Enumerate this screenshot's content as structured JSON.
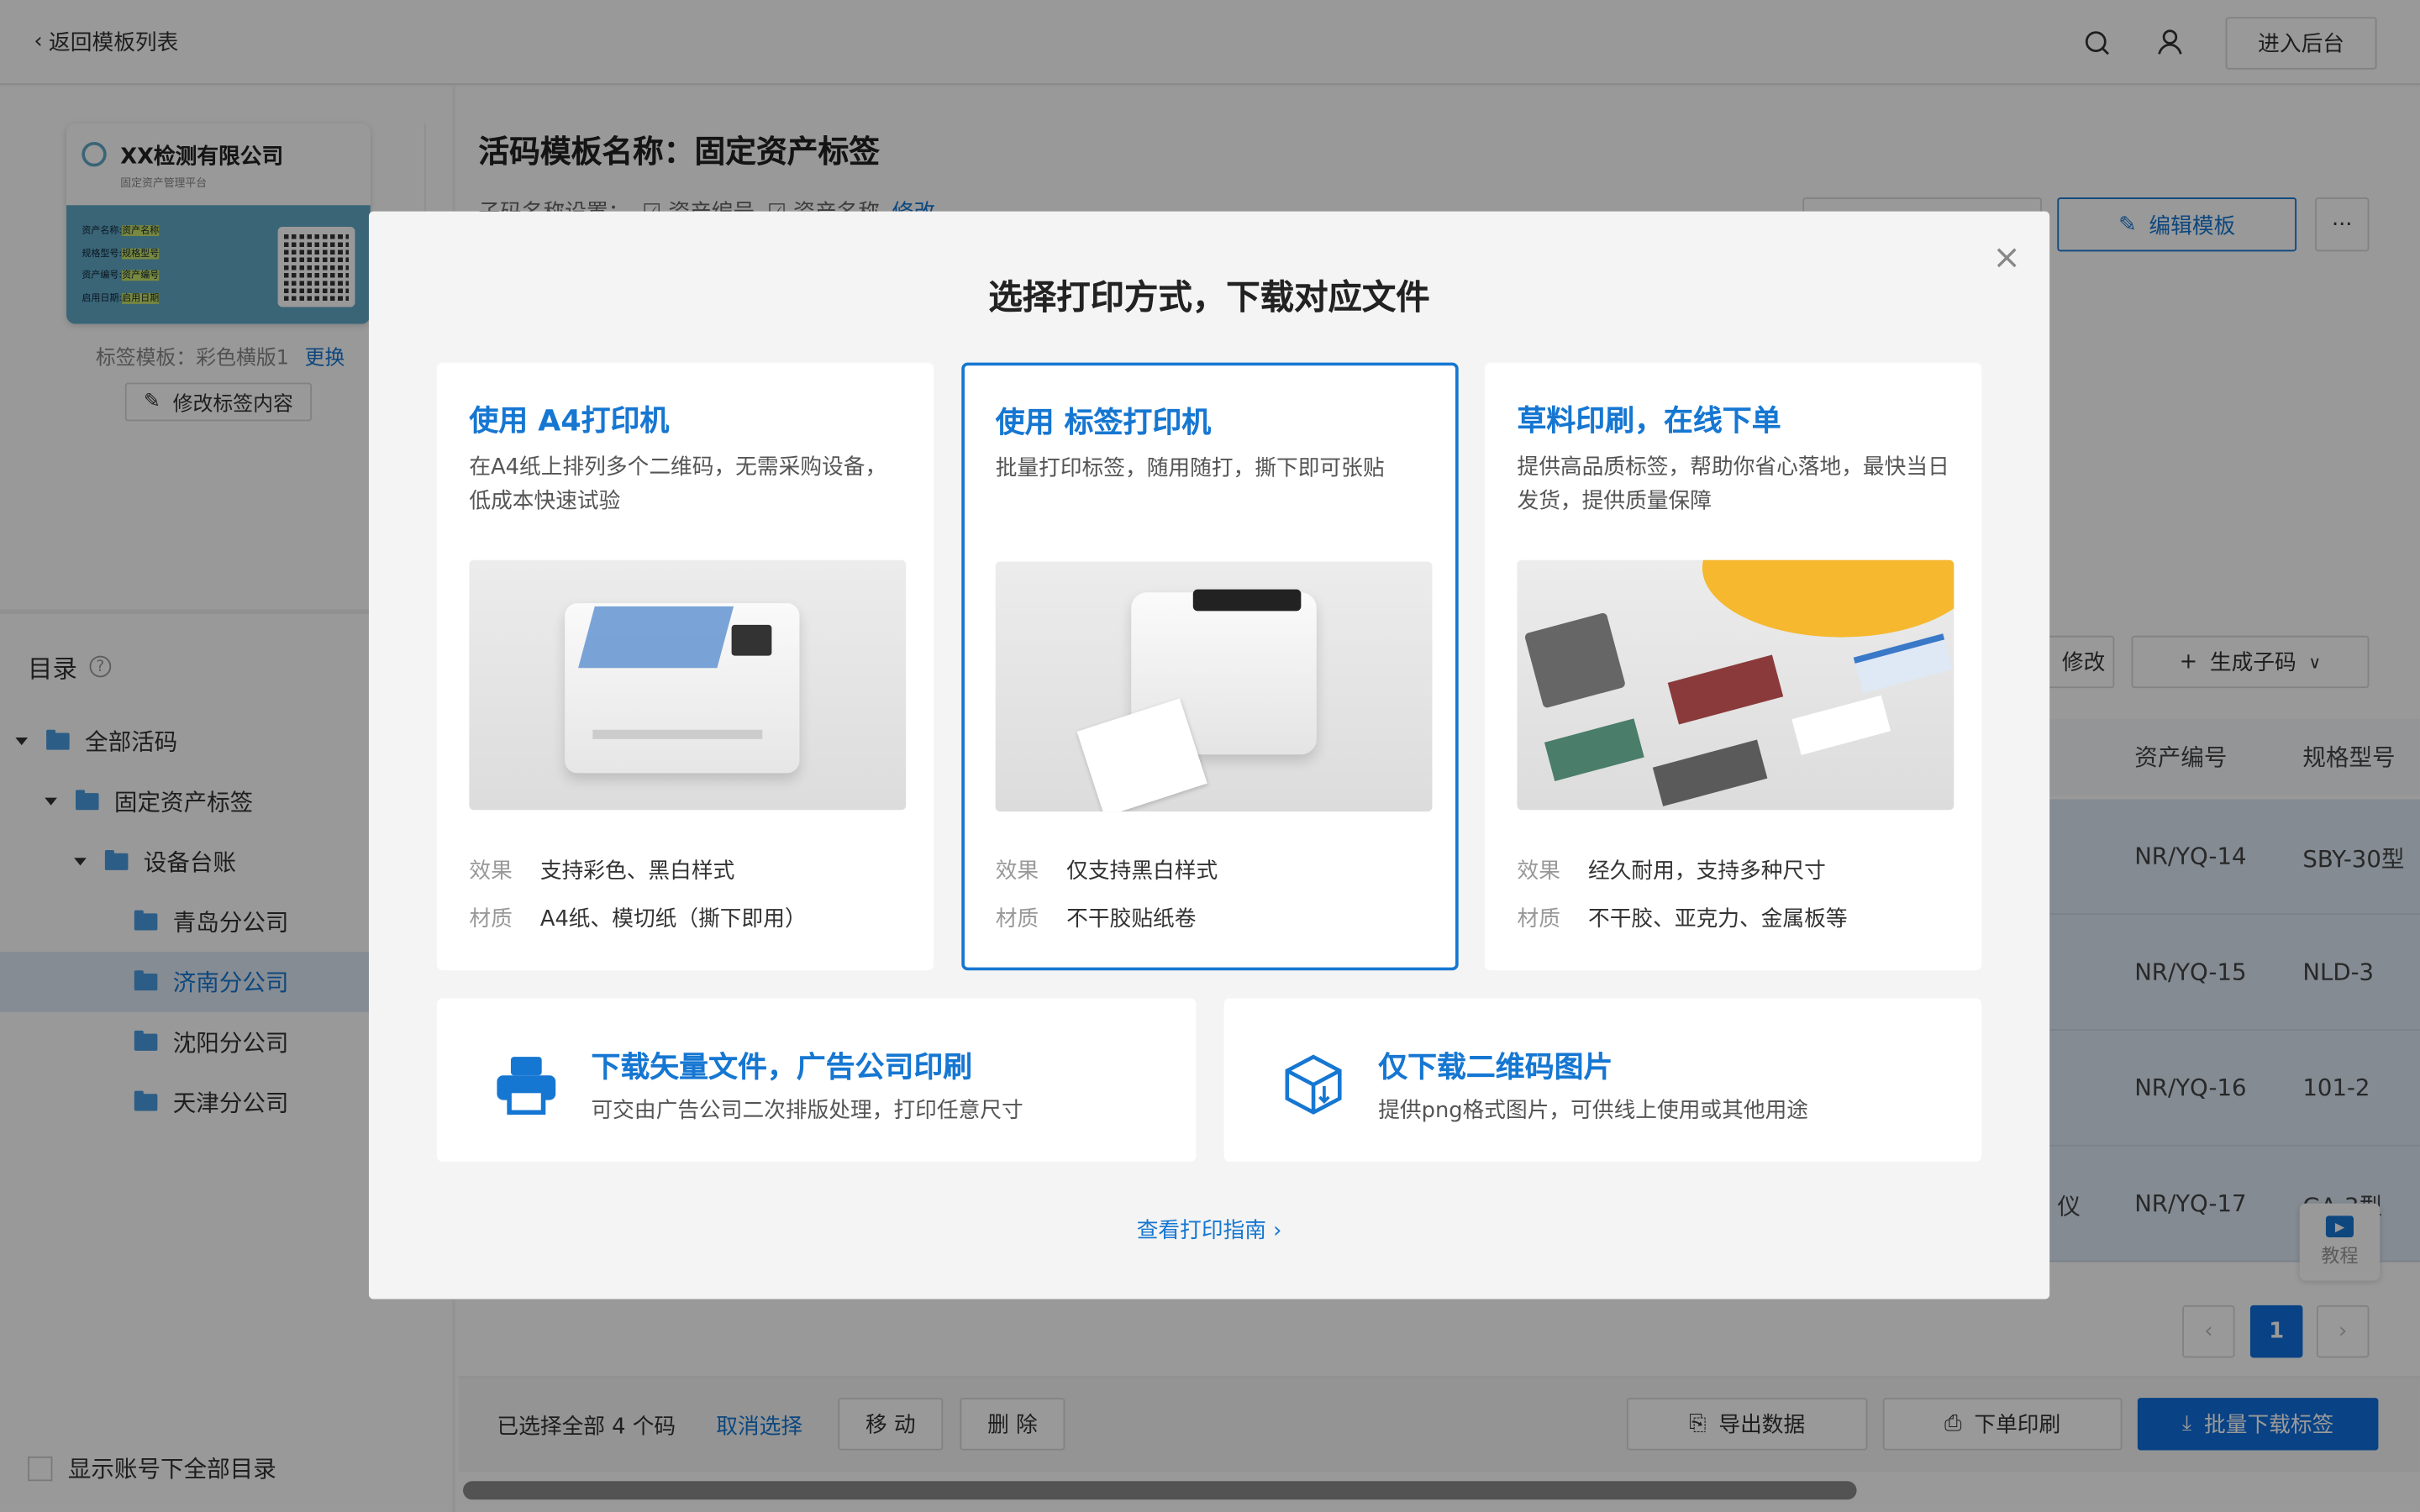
{
  "topbar": {
    "back_label": "返回模板列表",
    "admin_button": "进入后台",
    "search_icon": "search-icon",
    "user_icon": "user-icon"
  },
  "template_preview": {
    "company": "XX检测有限公司",
    "platform": "固定资产管理平台",
    "fields": [
      {
        "label": "资产名称:",
        "value": "资产名称"
      },
      {
        "label": "规格型号:",
        "value": "规格型号"
      },
      {
        "label": "资产编号:",
        "value": "资产编号"
      },
      {
        "label": "启用日期:",
        "value": "启用日期"
      }
    ],
    "template_label": "标签模板：彩色横版1",
    "change_link": "更换",
    "edit_content_button": "修改标签内容",
    "card_color": "#5fa8c6"
  },
  "header": {
    "title": "活码模板名称：固定资产标签",
    "subcode_setting_label": "子码名称设置：",
    "subcode_fields": [
      "资产编号",
      "资产名称"
    ],
    "modify_link": "修改",
    "edit_template_button": "编辑模板",
    "more_button": "···"
  },
  "directory": {
    "title": "目录",
    "help_icon": "help-circle-icon",
    "items": [
      {
        "label": "全部活码",
        "level": 0,
        "expanded": true
      },
      {
        "label": "固定资产标签",
        "level": 1,
        "expanded": true
      },
      {
        "label": "设备台账",
        "level": 2,
        "expanded": true
      },
      {
        "label": "青岛分公司",
        "level": 3
      },
      {
        "label": "济南分公司",
        "level": 3,
        "selected": true
      },
      {
        "label": "沈阳分公司",
        "level": 3
      },
      {
        "label": "天津分公司",
        "level": 3
      }
    ],
    "show_all_checkbox": "显示账号下全部目录",
    "show_all_checked": false
  },
  "table": {
    "modify_button": "修改",
    "generate_button": "生成子码",
    "columns": [
      "资产编号",
      "规格型号"
    ],
    "rows": [
      {
        "partial_name": "",
        "asset_no": "NR/YQ-14",
        "model": "SBY-30型"
      },
      {
        "partial_name": "",
        "asset_no": "NR/YQ-15",
        "model": "NLD-3"
      },
      {
        "partial_name": "",
        "asset_no": "NR/YQ-16",
        "model": "101-2"
      },
      {
        "partial_name": "仪",
        "asset_no": "NR/YQ-17",
        "model": "GA-3型"
      }
    ],
    "pagination": {
      "current": "1"
    },
    "tutorial_label": "教程"
  },
  "bottombar": {
    "selected_text": "已选择全部 4 个码",
    "cancel_select": "取消选择",
    "move_button": "移 动",
    "delete_button": "删 除",
    "export_button": "导出数据",
    "order_print_button": "下单印刷",
    "batch_download_button": "批量下载标签"
  },
  "modal": {
    "title": "选择打印方式，下载对应文件",
    "close_icon": "close-icon",
    "options": [
      {
        "title": "使用 A4打印机",
        "desc": "在A4纸上排列多个二维码，无需采购设备，低成本快速试验",
        "effect_label": "效果",
        "effect": "支持彩色、黑白样式",
        "material_label": "材质",
        "material": "A4纸、模切纸（撕下即用）"
      },
      {
        "title": "使用 标签打印机",
        "desc": "批量打印标签，随用随打，撕下即可张贴",
        "effect_label": "效果",
        "effect": "仅支持黑白样式",
        "material_label": "材质",
        "material": "不干胶贴纸卷",
        "selected": true
      },
      {
        "title": "草料印刷，在线下单",
        "desc": "提供高品质标签，帮助你省心落地，最快当日发货，提供质量保障",
        "effect_label": "效果",
        "effect": "经久耐用，支持多种尺寸",
        "material_label": "材质",
        "material": "不干胶、亚克力、金属板等"
      }
    ],
    "downloads": [
      {
        "title": "下载矢量文件，广告公司印刷",
        "desc": "可交由广告公司二次排版处理，打印任意尺寸",
        "icon": "printer-icon"
      },
      {
        "title": "仅下载二维码图片",
        "desc": "提供png格式图片，可供线上使用或其他用途",
        "icon": "box-download-icon"
      }
    ],
    "guide_link": "查看打印指南"
  },
  "colors": {
    "accent": "#1677d2",
    "primary_button": "#0f6fde",
    "overlay": "rgba(0,0,0,0.4)"
  }
}
